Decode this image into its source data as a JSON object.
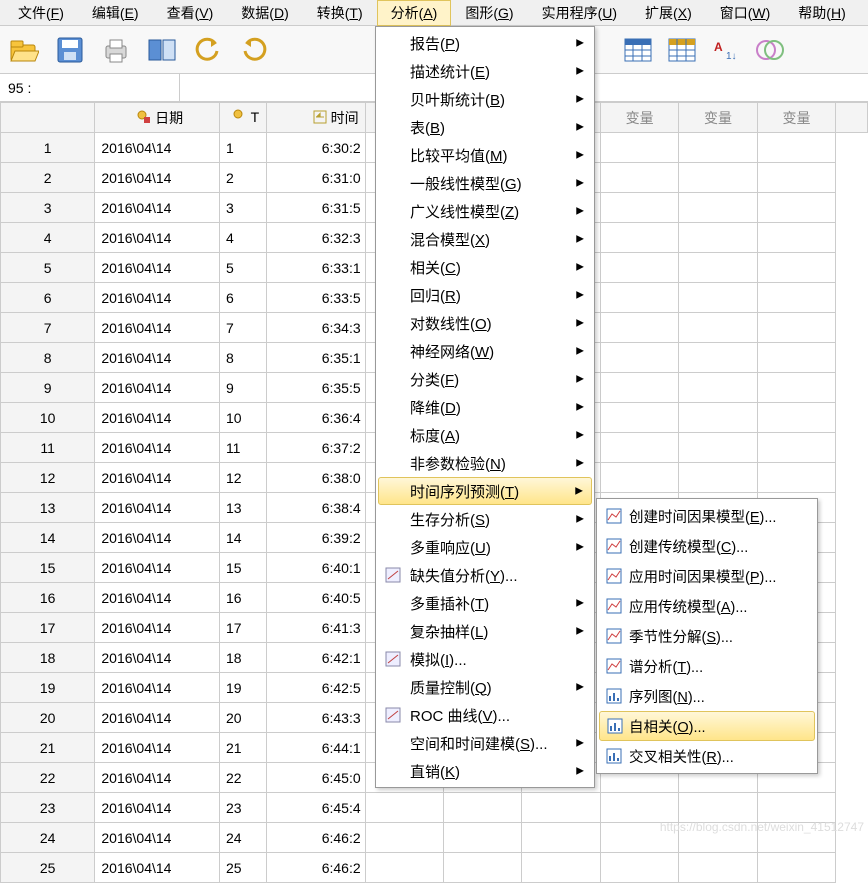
{
  "menubar": [
    {
      "label": "文件(F)",
      "key": "F"
    },
    {
      "label": "编辑(E)",
      "key": "E"
    },
    {
      "label": "查看(V)",
      "key": "V"
    },
    {
      "label": "数据(D)",
      "key": "D"
    },
    {
      "label": "转换(T)",
      "key": "T"
    },
    {
      "label": "分析(A)",
      "key": "A",
      "active": true
    },
    {
      "label": "图形(G)",
      "key": "G"
    },
    {
      "label": "实用程序(U)",
      "key": "U"
    },
    {
      "label": "扩展(X)",
      "key": "X"
    },
    {
      "label": "窗口(W)",
      "key": "W"
    },
    {
      "label": "帮助(H)",
      "key": "H"
    }
  ],
  "namebox": {
    "label": "95 :",
    "value": ""
  },
  "columns": {
    "rowhead": "",
    "date": "日期",
    "t": "T",
    "time": "时间",
    "var": "变量"
  },
  "rows": [
    {
      "n": "1",
      "date": "2016\\04\\14",
      "t": "1",
      "time": "6:30:2"
    },
    {
      "n": "2",
      "date": "2016\\04\\14",
      "t": "2",
      "time": "6:31:0"
    },
    {
      "n": "3",
      "date": "2016\\04\\14",
      "t": "3",
      "time": "6:31:5"
    },
    {
      "n": "4",
      "date": "2016\\04\\14",
      "t": "4",
      "time": "6:32:3"
    },
    {
      "n": "5",
      "date": "2016\\04\\14",
      "t": "5",
      "time": "6:33:1"
    },
    {
      "n": "6",
      "date": "2016\\04\\14",
      "t": "6",
      "time": "6:33:5"
    },
    {
      "n": "7",
      "date": "2016\\04\\14",
      "t": "7",
      "time": "6:34:3"
    },
    {
      "n": "8",
      "date": "2016\\04\\14",
      "t": "8",
      "time": "6:35:1"
    },
    {
      "n": "9",
      "date": "2016\\04\\14",
      "t": "9",
      "time": "6:35:5"
    },
    {
      "n": "10",
      "date": "2016\\04\\14",
      "t": "10",
      "time": "6:36:4"
    },
    {
      "n": "11",
      "date": "2016\\04\\14",
      "t": "11",
      "time": "6:37:2"
    },
    {
      "n": "12",
      "date": "2016\\04\\14",
      "t": "12",
      "time": "6:38:0"
    },
    {
      "n": "13",
      "date": "2016\\04\\14",
      "t": "13",
      "time": "6:38:4"
    },
    {
      "n": "14",
      "date": "2016\\04\\14",
      "t": "14",
      "time": "6:39:2"
    },
    {
      "n": "15",
      "date": "2016\\04\\14",
      "t": "15",
      "time": "6:40:1"
    },
    {
      "n": "16",
      "date": "2016\\04\\14",
      "t": "16",
      "time": "6:40:5"
    },
    {
      "n": "17",
      "date": "2016\\04\\14",
      "t": "17",
      "time": "6:41:3"
    },
    {
      "n": "18",
      "date": "2016\\04\\14",
      "t": "18",
      "time": "6:42:1"
    },
    {
      "n": "19",
      "date": "2016\\04\\14",
      "t": "19",
      "time": "6:42:5"
    },
    {
      "n": "20",
      "date": "2016\\04\\14",
      "t": "20",
      "time": "6:43:3"
    },
    {
      "n": "21",
      "date": "2016\\04\\14",
      "t": "21",
      "time": "6:44:1"
    },
    {
      "n": "22",
      "date": "2016\\04\\14",
      "t": "22",
      "time": "6:45:0"
    },
    {
      "n": "23",
      "date": "2016\\04\\14",
      "t": "23",
      "time": "6:45:4"
    },
    {
      "n": "24",
      "date": "2016\\04\\14",
      "t": "24",
      "time": "6:46:2"
    },
    {
      "n": "25",
      "date": "2016\\04\\14",
      "t": "25",
      "time": "6:46:2"
    }
  ],
  "analyze_menu": [
    {
      "label": "报告(P)",
      "arrow": true
    },
    {
      "label": "描述统计(E)",
      "arrow": true
    },
    {
      "label": "贝叶斯统计(B)",
      "arrow": true
    },
    {
      "label": "表(B)",
      "arrow": true
    },
    {
      "label": "比较平均值(M)",
      "arrow": true
    },
    {
      "label": "一般线性模型(G)",
      "arrow": true
    },
    {
      "label": "广义线性模型(Z)",
      "arrow": true
    },
    {
      "label": "混合模型(X)",
      "arrow": true
    },
    {
      "label": "相关(C)",
      "arrow": true
    },
    {
      "label": "回归(R)",
      "arrow": true
    },
    {
      "label": "对数线性(O)",
      "arrow": true
    },
    {
      "label": "神经网络(W)",
      "arrow": true
    },
    {
      "label": "分类(F)",
      "arrow": true
    },
    {
      "label": "降维(D)",
      "arrow": true
    },
    {
      "label": "标度(A)",
      "arrow": true
    },
    {
      "label": "非参数检验(N)",
      "arrow": true
    },
    {
      "label": "时间序列预测(T)",
      "arrow": true,
      "hover": true
    },
    {
      "label": "生存分析(S)",
      "arrow": true
    },
    {
      "label": "多重响应(U)",
      "arrow": true
    },
    {
      "label": "缺失值分析(Y)...",
      "arrow": false,
      "icon": true
    },
    {
      "label": "多重插补(T)",
      "arrow": true
    },
    {
      "label": "复杂抽样(L)",
      "arrow": true
    },
    {
      "label": "模拟(I)...",
      "arrow": false,
      "icon": true
    },
    {
      "label": "质量控制(Q)",
      "arrow": true
    },
    {
      "label": "ROC 曲线(V)...",
      "arrow": false,
      "icon": true
    },
    {
      "label": "空间和时间建模(S)...",
      "arrow": true
    },
    {
      "label": "直销(K)",
      "arrow": true
    }
  ],
  "ts_submenu": [
    {
      "label": "创建时间因果模型(E)...",
      "icon": "chart"
    },
    {
      "label": "创建传统模型(C)...",
      "icon": "chart"
    },
    {
      "label": "应用时间因果模型(P)...",
      "icon": "chart"
    },
    {
      "label": "应用传统模型(A)...",
      "icon": "chart"
    },
    {
      "label": "季节性分解(S)...",
      "icon": "chart"
    },
    {
      "label": "谱分析(T)...",
      "icon": "chart"
    },
    {
      "label": "序列图(N)...",
      "icon": "bars"
    },
    {
      "label": "自相关(O)...",
      "icon": "bars",
      "hover": true
    },
    {
      "label": "交叉相关性(R)...",
      "icon": "bars"
    }
  ],
  "watermark": "https://blog.csdn.net/weixin_41512747"
}
